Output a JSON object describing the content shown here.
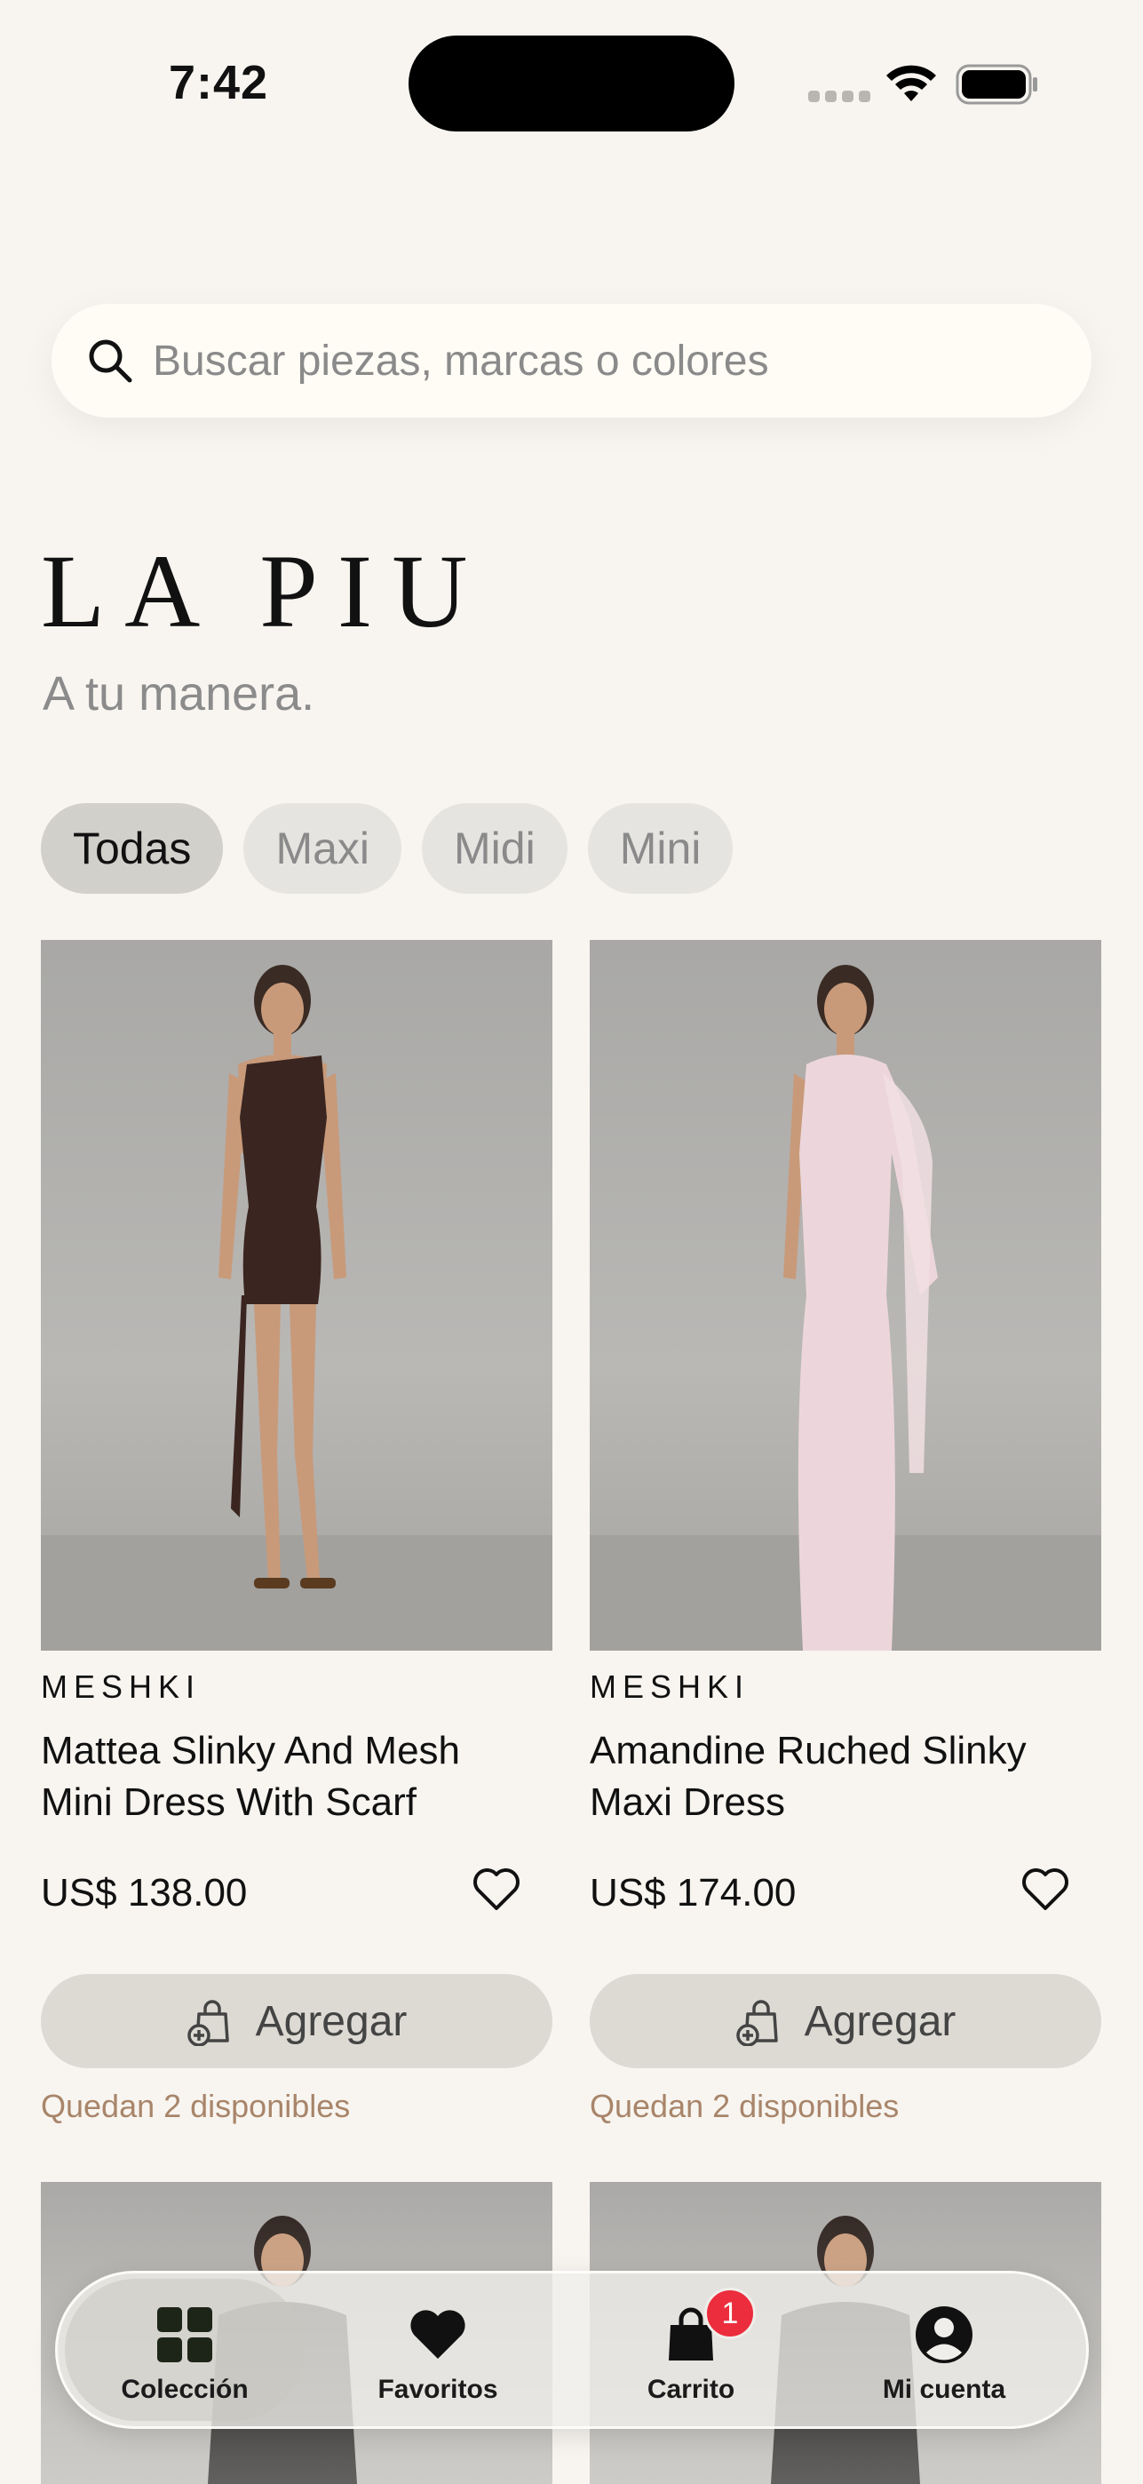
{
  "status_bar": {
    "time": "7:42"
  },
  "search": {
    "placeholder": "Buscar piezas, marcas o colores"
  },
  "brand": {
    "title": "LA PIU",
    "tagline": "A tu manera."
  },
  "filters": [
    {
      "label": "Todas",
      "active": true
    },
    {
      "label": "Maxi",
      "active": false
    },
    {
      "label": "Midi",
      "active": false
    },
    {
      "label": "Mini",
      "active": false
    }
  ],
  "products": [
    {
      "brand": "MESHKI",
      "name": "Mattea Slinky And Mesh Mini Dress With Scarf",
      "price": "US$ 138.00",
      "add_label": "Agregar",
      "stock": "Quedan 2 disponibles",
      "dress_color": "#3a2520"
    },
    {
      "brand": "MESHKI",
      "name": "Amandine Ruched Slinky Maxi Dress",
      "price": "US$ 174.00",
      "add_label": "Agregar",
      "stock": "Quedan 2 disponibles",
      "dress_color": "#ecd6dc"
    }
  ],
  "tabbar": {
    "items": [
      {
        "label": "Colección",
        "icon": "grid-icon",
        "active": true
      },
      {
        "label": "Favoritos",
        "icon": "heart-icon",
        "active": false
      },
      {
        "label": "Carrito",
        "icon": "bag-icon",
        "active": false,
        "badge": "1"
      },
      {
        "label": "Mi cuenta",
        "icon": "person-icon",
        "active": false
      }
    ]
  },
  "colors": {
    "background": "#f8f5f0",
    "accent_stock": "#a8856a",
    "badge": "#ec2d3d"
  }
}
